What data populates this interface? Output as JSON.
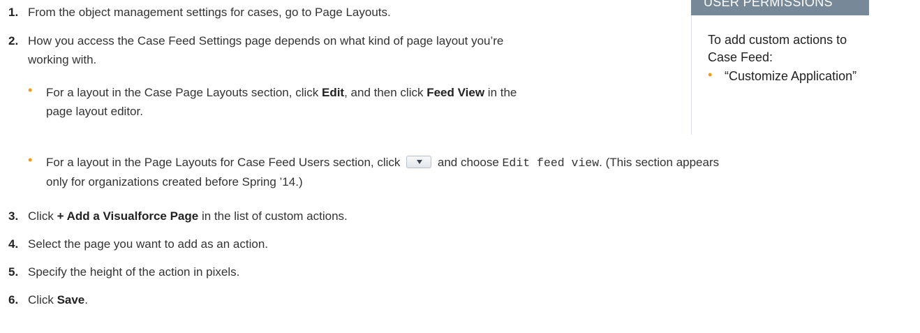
{
  "steps": [
    {
      "num": "1.",
      "parts": [
        "From the object management settings for cases, go to Page Layouts."
      ]
    },
    {
      "num": "2.",
      "parts": [
        "How you access the Case Feed Settings page depends on what kind of page layout you’re",
        "working with."
      ]
    }
  ],
  "bullets": [
    {
      "a": "For a layout in the Case Page Layouts section, click ",
      "b1": "Edit",
      "c": ", and then click ",
      "b2": "Feed View",
      "d": " in the",
      "e": "page layout editor."
    },
    {
      "a": "For a layout in the Page Layouts for Case Feed Users section, click",
      "c": "and choose",
      "code": "Edit feed view",
      "d": ". (This section appears",
      "e": "only for organizations created before Spring ’14.)"
    }
  ],
  "step3": {
    "num": "3.",
    "pre": "Click ",
    "bold": "+ Add a Visualforce Page",
    "post": " in the list of custom actions."
  },
  "step4": {
    "num": "4.",
    "text": "Select the page you want to add as an action."
  },
  "step5": {
    "num": "5.",
    "text": "Specify the height of the action in pixels."
  },
  "step6": {
    "num": "6.",
    "pre": "Click ",
    "bold": "Save",
    "post": "."
  },
  "sidebar": {
    "header": "USER PERMISSIONS",
    "intro_line1": "To add custom actions to",
    "intro_line2": "Case Feed:",
    "permission": "“Customize Application”"
  },
  "colors": {
    "bullet": "#f39c12",
    "header_bg": "#778999",
    "text": "#333333"
  }
}
